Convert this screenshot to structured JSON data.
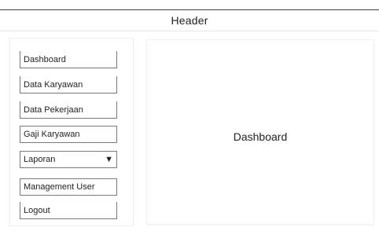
{
  "header": {
    "title": "Header"
  },
  "sidebar": {
    "items": [
      {
        "label": "Dashboard"
      },
      {
        "label": "Data Karyawan"
      },
      {
        "label": "Data Pekerjaan"
      },
      {
        "label": "Gaji Karyawan"
      },
      {
        "label": "Laporan",
        "icon": "caret-down-icon"
      },
      {
        "label": "Management User"
      },
      {
        "label": "Logout"
      }
    ]
  },
  "main": {
    "title": "Dashboard"
  }
}
